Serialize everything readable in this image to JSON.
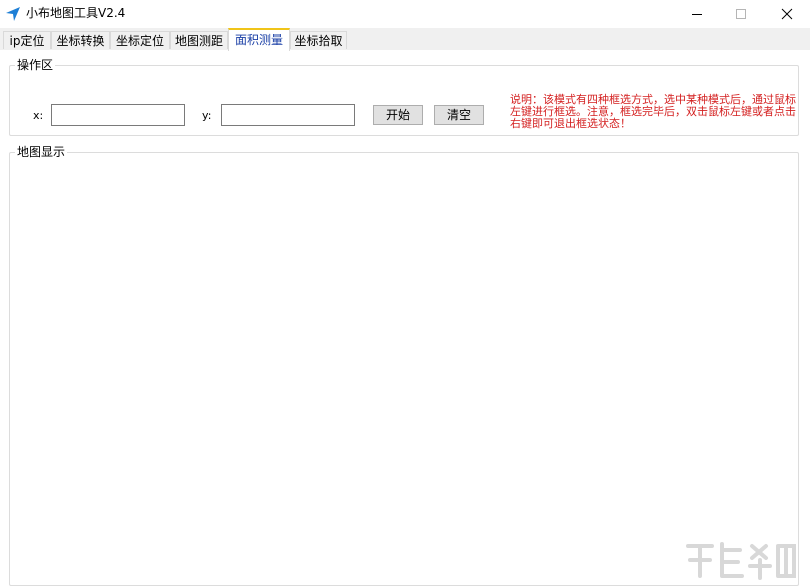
{
  "window": {
    "title": "小布地图工具V2.4",
    "controls": {
      "minimize": "—",
      "maximize": "☐",
      "close": "✕"
    }
  },
  "tabs": [
    {
      "label": "ip定位",
      "active": false
    },
    {
      "label": "坐标转换",
      "active": false
    },
    {
      "label": "坐标定位",
      "active": false
    },
    {
      "label": "地图测距",
      "active": false
    },
    {
      "label": "面积测量",
      "active": true
    },
    {
      "label": "坐标拾取",
      "active": false
    }
  ],
  "operation_area": {
    "title": "操作区",
    "x_label": "x:",
    "x_value": "",
    "y_label": "y:",
    "y_value": "",
    "start_button": "开始",
    "clear_button": "清空",
    "note": "说明：该模式有四种框选方式，选中某种模式后，通过鼠标左键进行框选。注意，框选完毕后，双击鼠标左键或者点击右键即可退出框选状态！"
  },
  "map_display": {
    "title": "地图显示"
  },
  "colors": {
    "accent_tab_text": "#1a3fa6",
    "note_text": "#d42020",
    "app_icon": "#1e7fd6"
  }
}
